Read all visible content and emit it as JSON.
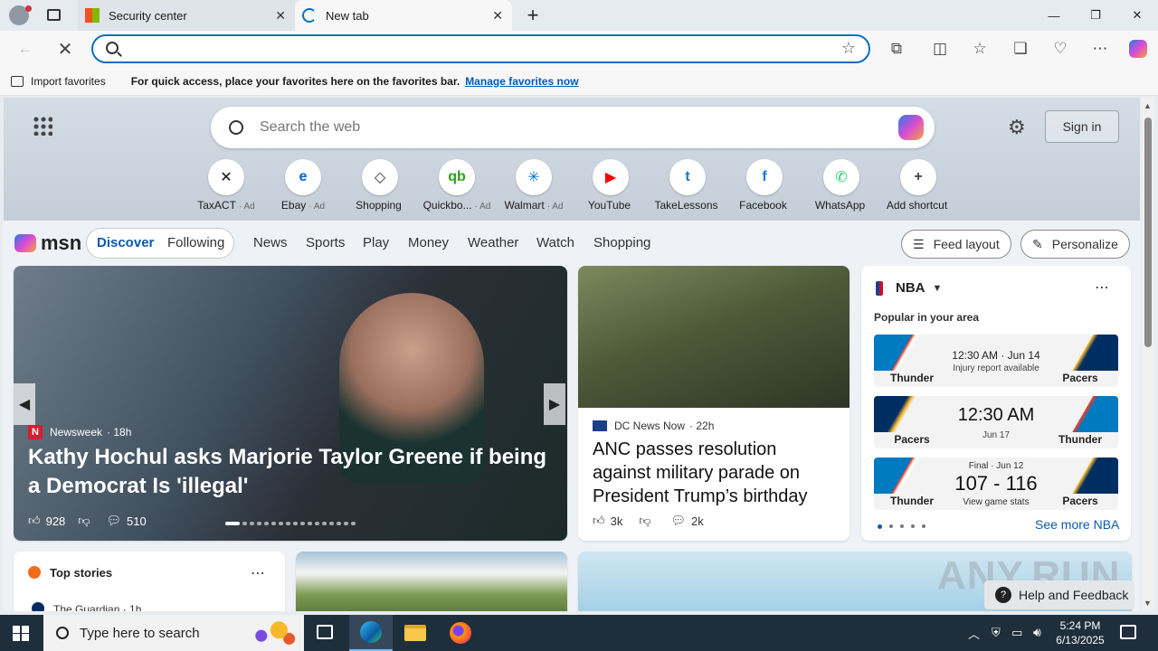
{
  "tabs": [
    {
      "title": "Security center",
      "close": "✕"
    },
    {
      "title": "New tab",
      "close": "✕"
    }
  ],
  "window": {
    "new_tab": "+",
    "minimize": "—",
    "restore": "❐",
    "close": "✕"
  },
  "address": {
    "value": "",
    "placeholder": ""
  },
  "favorites_bar": {
    "import": "Import favorites",
    "message": "For quick access, place your favorites here on the favorites bar.",
    "manage": "Manage favorites now"
  },
  "search": {
    "placeholder": "Search the web"
  },
  "signin": "Sign in",
  "shortcuts": [
    {
      "name": "TaxACT",
      "ad": "· Ad",
      "icon": "taxact-icon",
      "color": "#111111",
      "glyph": "✕"
    },
    {
      "name": "Ebay",
      "ad": "· Ad",
      "icon": "ebay-icon",
      "color": "#0064d2",
      "glyph": "e"
    },
    {
      "name": "Shopping",
      "ad": "",
      "icon": "tag-icon",
      "color": "#333333",
      "glyph": "◇"
    },
    {
      "name": "Quickbo...",
      "ad": "· Ad",
      "icon": "quickbooks-icon",
      "color": "#2ca01c",
      "glyph": "qb"
    },
    {
      "name": "Walmart",
      "ad": "· Ad",
      "icon": "walmart-icon",
      "color": "#0071ce",
      "glyph": "✳"
    },
    {
      "name": "YouTube",
      "ad": "",
      "icon": "youtube-icon",
      "color": "#ff0000",
      "glyph": "▶"
    },
    {
      "name": "TakeLessons",
      "ad": "",
      "icon": "takelessons-icon",
      "color": "#1e73be",
      "glyph": "t"
    },
    {
      "name": "Facebook",
      "ad": "",
      "icon": "facebook-icon",
      "color": "#1877f2",
      "glyph": "f"
    },
    {
      "name": "WhatsApp",
      "ad": "",
      "icon": "whatsapp-icon",
      "color": "#25d366",
      "glyph": "✆"
    },
    {
      "name": "Add shortcut",
      "ad": "",
      "icon": "plus-icon",
      "color": "#444444",
      "glyph": "+"
    }
  ],
  "msn": {
    "logo": "msn",
    "tabs": [
      "Discover",
      "Following"
    ],
    "nav": [
      "News",
      "Sports",
      "Play",
      "Money",
      "Weather",
      "Watch",
      "Shopping"
    ],
    "feed_layout": "Feed layout",
    "personalize": "Personalize"
  },
  "hero_story": {
    "source": "Newsweek",
    "age": "· 18h",
    "headline": "Kathy Hochul asks Marjorie Taylor Greene if being a Democrat Is 'illegal'",
    "likes": "928",
    "comments": "510"
  },
  "story2": {
    "source": "DC News Now",
    "age": "· 22h",
    "headline": "ANC passes resolution against military parade on President Trump’s birthday",
    "likes": "3k",
    "comments": "2k"
  },
  "nba": {
    "title": "NBA",
    "subtitle": "Popular in your area",
    "games": [
      {
        "left": "Thunder",
        "right": "Pacers",
        "line1": "12:30 AM · Jun 14",
        "line2": "Injury report available",
        "big": ""
      },
      {
        "left": "Pacers",
        "right": "Thunder",
        "line1": "",
        "line2": "Jun 17",
        "big": "12:30 AM"
      },
      {
        "left": "Thunder",
        "right": "Pacers",
        "line1": "Final · Jun 12",
        "line2": "View game stats",
        "big": "107 - 116"
      }
    ],
    "see_more": "See more NBA"
  },
  "top_stories": {
    "title": "Top stories",
    "source": "The Guardian · 1h"
  },
  "help": "Help and Feedback",
  "watermark": "ANY.RUN",
  "taskbar": {
    "search": "Type here to search",
    "time": "5:24 PM",
    "date": "6/13/2025"
  }
}
